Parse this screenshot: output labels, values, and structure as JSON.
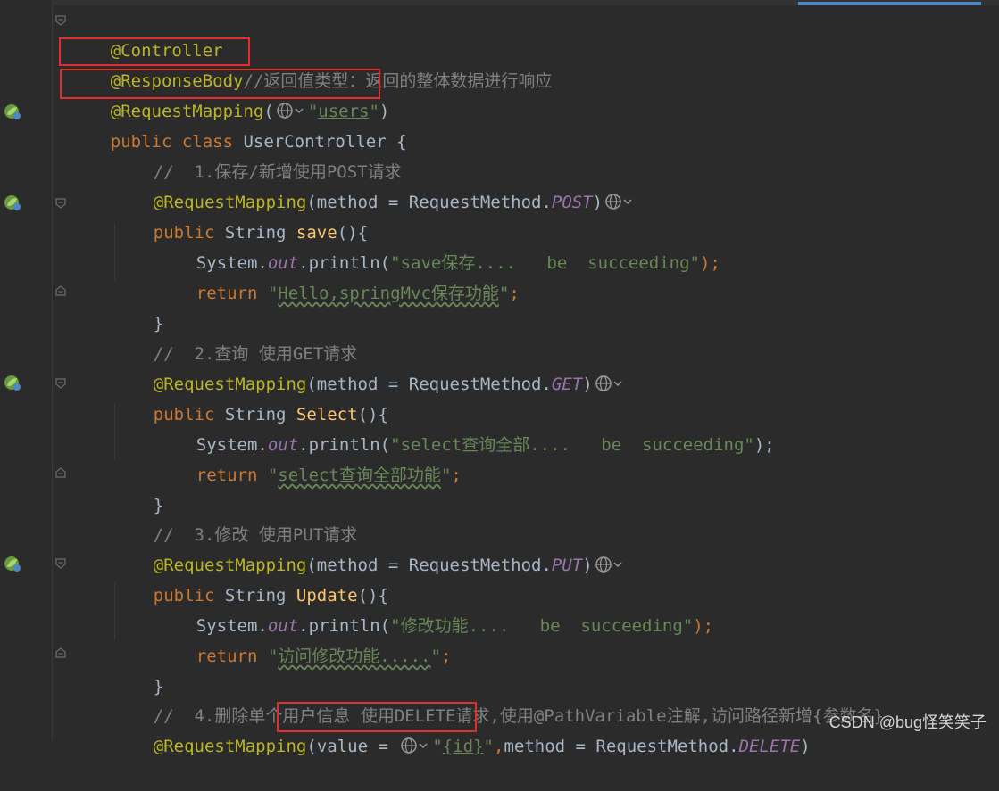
{
  "watermark": "CSDN @bug怪笑笑子",
  "icons": {
    "gutter": "spring-bean-icon",
    "fold": "fold-marker-icon",
    "url": "globe-icon"
  },
  "colors": {
    "background": "#2b2b2b",
    "annotation": "#bbb529",
    "keyword": "#cc7832",
    "string": "#6a8759",
    "comment": "#808080",
    "static_field": "#9876aa",
    "method_decl": "#ffc66d",
    "plain": "#a9b7c6",
    "highlight_box": "#e0302c"
  },
  "code": {
    "l1": {
      "ann": "@Controller"
    },
    "l2": {
      "ann": "@ResponseBody",
      "cmt": "//返回值类型：返回的整体数据进行响应"
    },
    "l3": {
      "ann": "@RequestMapping",
      "open": "(",
      "q1": "\"",
      "url": "users",
      "q2": "\"",
      "close": ")"
    },
    "l4": {
      "kw": "public class",
      "name": " UserController {"
    },
    "l5": {
      "cmt": "//  1.保存/新增使用POST请求"
    },
    "l6": {
      "ann": "@RequestMapping",
      "pre": "(method = RequestMethod.",
      "fld": "POST",
      "close": ")"
    },
    "l7": {
      "kw": "public",
      "type": " String ",
      "mth": "save",
      "rest": "(){"
    },
    "l8": {
      "pre": "System.",
      "fld": "out",
      "mid": ".println(",
      "str": "\"save保存....   be  succeeding\"",
      "kw": ");"
    },
    "l9": {
      "kw": "return",
      "q1": " \"",
      "str": "Hello,springMvc保存功能",
      "q2": "\"",
      "semi": ";"
    },
    "l10": {
      "brace": "}"
    },
    "l11": {
      "cmt": "//  2.查询 使用GET请求"
    },
    "l12": {
      "ann": "@RequestMapping",
      "pre": "(method = RequestMethod.",
      "fld": "GET",
      "close": ")"
    },
    "l13": {
      "kw": "public",
      "type": " String ",
      "mth": "Select",
      "rest": "(){"
    },
    "l14": {
      "pre": "System.",
      "fld": "out",
      "mid": ".println(",
      "str": "\"select查询全部....   be  succeeding\"",
      "close": ");"
    },
    "l15": {
      "kw": "return",
      "q1": " \"",
      "str": "select查询全部功能",
      "q2": "\"",
      "semi": ";"
    },
    "l16": {
      "brace": "}"
    },
    "l17": {
      "cmt": "//  3.修改 使用PUT请求"
    },
    "l18": {
      "ann": "@RequestMapping",
      "pre": "(method = RequestMethod.",
      "fld": "PUT",
      "close": ")"
    },
    "l19": {
      "kw": "public",
      "type": " String ",
      "mth": "Update",
      "rest": "(){"
    },
    "l20": {
      "pre": "System.",
      "fld": "out",
      "mid": ".println(",
      "str": "\"修改功能....   be  succeeding\"",
      "kw": ");"
    },
    "l21": {
      "kw": "return",
      "q1": " \"",
      "str": "访问修改功能.....",
      "q2": "\"",
      "semi": ";"
    },
    "l22": {
      "brace": "}"
    },
    "l23": {
      "cmt": "//  4.删除单个用户信息 使用DELETE请求,使用@PathVariable注解,访问路径新增{参数名}"
    },
    "l24": {
      "ann": "@RequestMapping",
      "open": "(",
      "val": "value = ",
      "q1": "\"",
      "url": "{id}",
      "q2": "\"",
      "comma": ",",
      "post": "method = RequestMethod.",
      "fld": "DELETE",
      "close": ")"
    }
  }
}
